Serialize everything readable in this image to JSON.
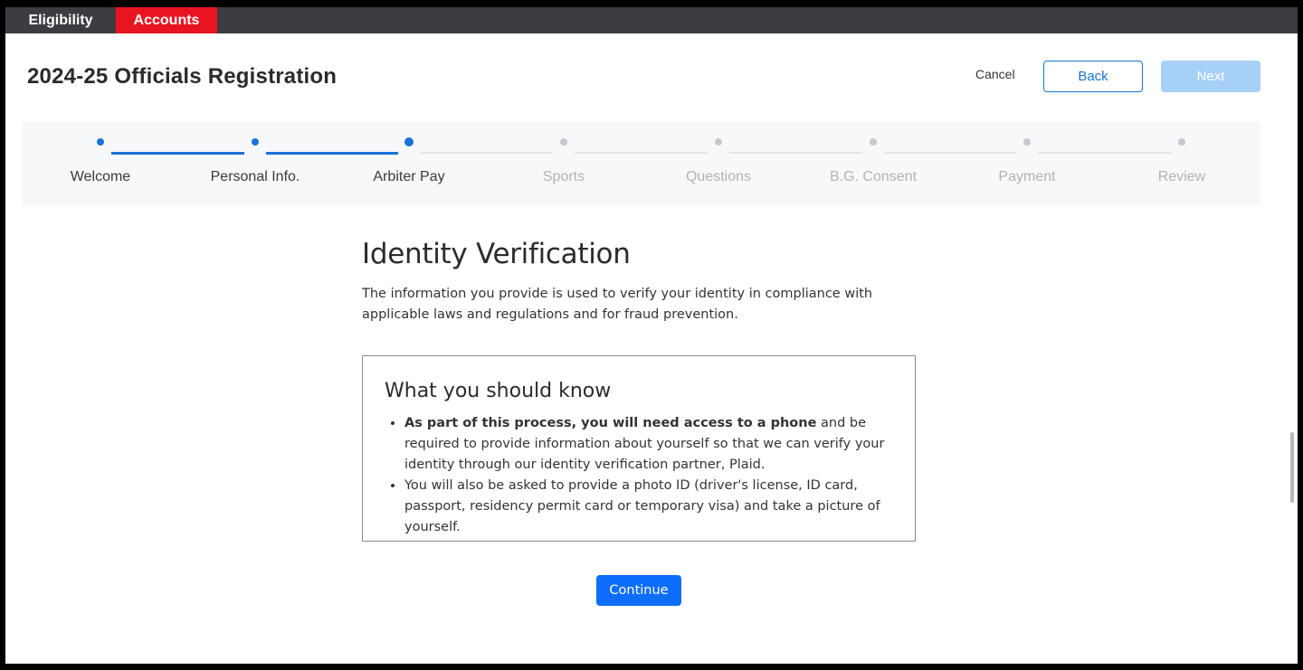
{
  "nav": {
    "tabs": [
      {
        "label": "Eligibility",
        "active": false
      },
      {
        "label": "Accounts",
        "active": true
      }
    ],
    "active_color": "#e8141f"
  },
  "header": {
    "title": "2024-25 Officials Registration",
    "cancel_label": "Cancel",
    "back_label": "Back",
    "next_label": "Next"
  },
  "steps": [
    {
      "label": "Welcome",
      "state": "done"
    },
    {
      "label": "Personal Info.",
      "state": "done"
    },
    {
      "label": "Arbiter Pay",
      "state": "current"
    },
    {
      "label": "Sports",
      "state": "pending"
    },
    {
      "label": "Questions",
      "state": "pending"
    },
    {
      "label": "B.G. Consent",
      "state": "pending"
    },
    {
      "label": "Payment",
      "state": "pending"
    },
    {
      "label": "Review",
      "state": "pending"
    }
  ],
  "main": {
    "title": "Identity Verification",
    "intro": "The information you provide is used to verify your identity in compliance with applicable laws and regulations and for fraud prevention.",
    "info_box": {
      "title": "What you should know",
      "bullet1_bold": "As part of this process, you will need access to a phone",
      "bullet1_rest": " and be required to provide information about yourself so that we can verify your identity through our identity verification partner, Plaid.",
      "bullet2": "You will also be asked to provide a photo ID (driver's license, ID card, passport, residency permit card or temporary visa) and take a picture of yourself."
    },
    "continue_label": "Continue"
  },
  "colors": {
    "primary": "#1a73d6",
    "next_disabled": "#a7d0f7",
    "continue": "#0d6efd"
  }
}
